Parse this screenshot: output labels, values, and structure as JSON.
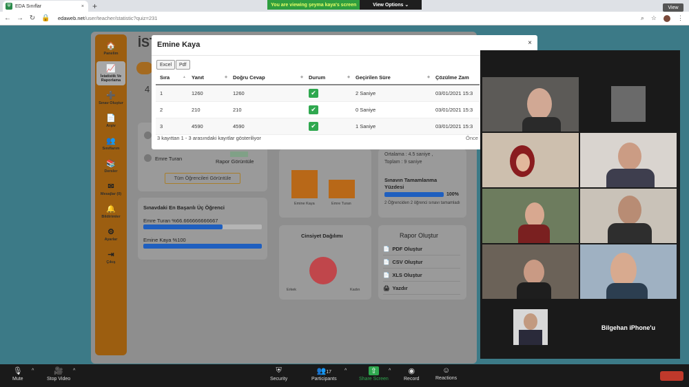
{
  "browser": {
    "tab_title": "EDA Sınıflar",
    "tab_close": "×",
    "new_tab": "+",
    "url_host": "edaweb.net",
    "url_path": "/user/teacher/statistic?quiz=231",
    "view_label": "View"
  },
  "share_banner": {
    "text": "You are viewing şeyma kaya's screen",
    "options": "View Options"
  },
  "sidebar": {
    "items": [
      {
        "label": "Panelim",
        "icon": "🏠"
      },
      {
        "label": "İstatistik Ve Raporlama",
        "icon": "📈"
      },
      {
        "label": "Sınav Oluştur",
        "icon": "➕"
      },
      {
        "label": "Arşiv",
        "icon": "📄"
      },
      {
        "label": "Sınıflarım",
        "icon": "👥"
      },
      {
        "label": "Dersler",
        "icon": "📚"
      },
      {
        "label": "Mesajlar (0)",
        "icon": "✉"
      },
      {
        "label": "Bildirimler",
        "icon": "🔔"
      },
      {
        "label": "Ayarlar",
        "icon": "⚙"
      },
      {
        "label": "Çıkış",
        "icon": "⇥"
      }
    ]
  },
  "page": {
    "heading_partial": "İST",
    "count_partial": "4",
    "student_name": "Emre Turan",
    "report_view": "Rapor Görüntüle",
    "all_students_btn": "Tüm Öğrencileri Görüntüle",
    "top_students": {
      "title": "Sınavdaki En Başarılı Üç Öğrenci",
      "items": [
        {
          "label": "Emre Turan %66.666666666667",
          "percent": 66.67
        },
        {
          "label": "Emine Kaya %100",
          "percent": 100
        }
      ]
    },
    "bar_labels": [
      "Emine Kaya",
      "Emre Turan"
    ],
    "gender": {
      "title": "Cinsiyet Dağılımı",
      "left": "Erkek",
      "right": "Kadın"
    },
    "stats": {
      "avg_line1": "Ortalama : 4.5 saniye ,",
      "avg_line2": "Toplam : 9 saniye",
      "completion_title": "Sınavın Tamamlanma Yüzdesi",
      "completion_percent_text": "100%",
      "completion_percent": 100,
      "completion_note": "2 Öğrenciden 2 öğrenci sınavı tamamladı"
    },
    "report": {
      "title": "Rapor Oluştur",
      "items": [
        {
          "label": "PDF Oluştur",
          "icon": "📄"
        },
        {
          "label": "CSV Oluştur",
          "icon": "📄"
        },
        {
          "label": "XLS Oluştur",
          "icon": "📄"
        },
        {
          "label": "Yazdır",
          "icon": "🖨"
        }
      ]
    }
  },
  "modal": {
    "title": "Emine Kaya",
    "close": "×",
    "buttons": {
      "excel": "Excel",
      "pdf": "Pdf"
    },
    "columns": [
      "Sıra",
      "Yanıt",
      "Doğru Cevap",
      "Durum",
      "Geçirilen Süre",
      "Çözülme Zam"
    ],
    "rows": [
      {
        "sira": "1",
        "yanit": "1260",
        "dogru": "1260",
        "durum": "✔",
        "sure": "2 Saniye",
        "zaman": "03/01/2021 15:3"
      },
      {
        "sira": "2",
        "yanit": "210",
        "dogru": "210",
        "durum": "✔",
        "sure": "0 Saniye",
        "zaman": "03/01/2021 15:3"
      },
      {
        "sira": "3",
        "yanit": "4590",
        "dogru": "4590",
        "durum": "✔",
        "sure": "1 Saniye",
        "zaman": "03/01/2021 15:3"
      }
    ],
    "info": "3 kayıttan 1 - 3 arasındaki kayıtlar gösteriliyor",
    "prev": "Önce"
  },
  "video": {
    "named_tile": "Bilgehan iPhone'u"
  },
  "zoom_toolbar": {
    "mute": "Mute",
    "stop_video": "Stop Video",
    "security": "Security",
    "participants": "Participants",
    "participant_count": "17",
    "share": "Share Screen",
    "record": "Record",
    "reactions": "Reactions"
  },
  "colors": {
    "sidebar": "#9c5e10",
    "page_bg": "#3c7a87",
    "success": "#2fa84f",
    "progress": "#1f5fbf",
    "bar_orange": "#b86818",
    "pie": "#c0464b"
  }
}
